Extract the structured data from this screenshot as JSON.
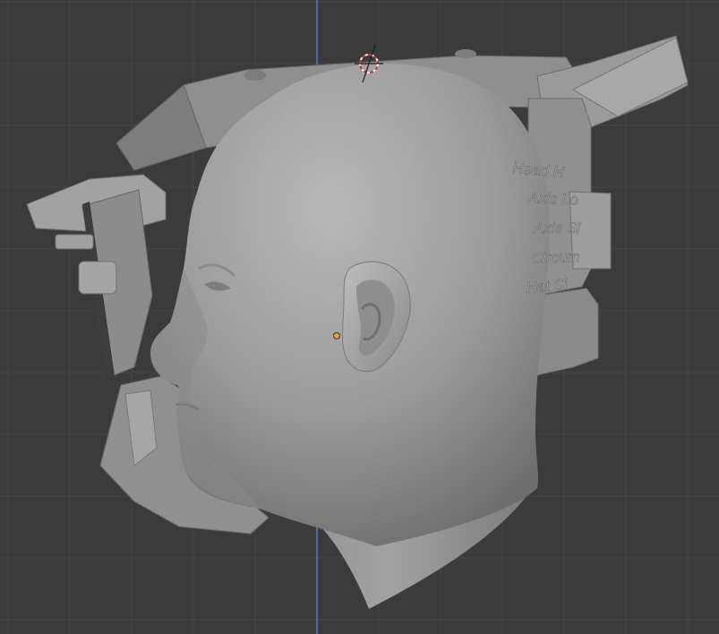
{
  "viewport": {
    "background": "#3b3b3b",
    "grid_color": "#464646",
    "axis_color": "#4f7cc4",
    "object_origin_color": "#f0a030"
  },
  "head_engravings": [
    "Head H",
    "Axis Lo",
    "Axis Si",
    "Circum",
    "Hat Si"
  ]
}
